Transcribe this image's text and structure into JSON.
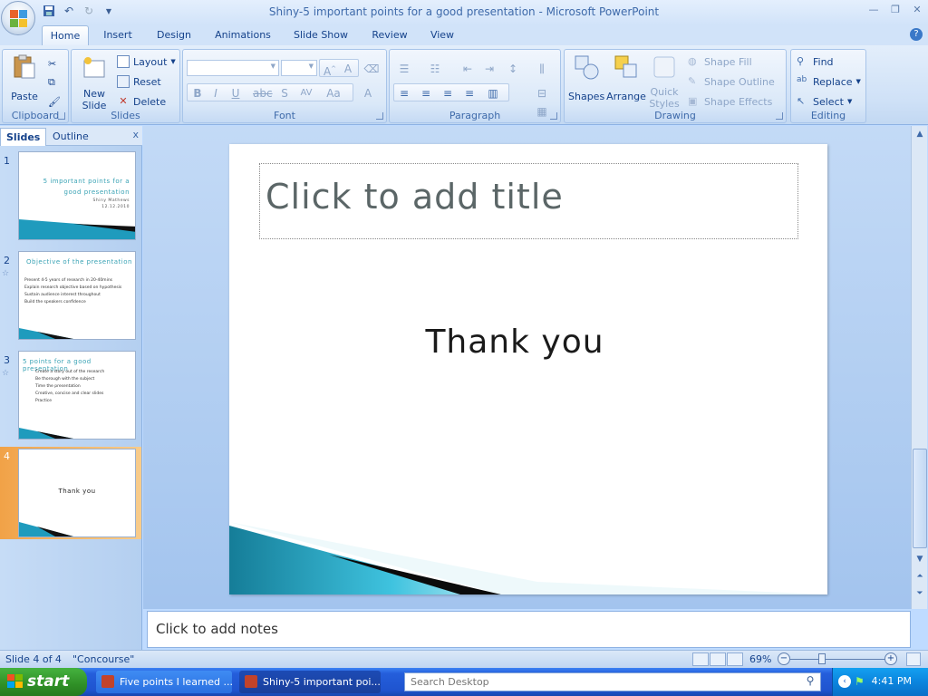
{
  "window": {
    "title": "Shiny-5 important points for a good presentation - Microsoft PowerPoint"
  },
  "tabs": [
    "Home",
    "Insert",
    "Design",
    "Animations",
    "Slide Show",
    "Review",
    "View"
  ],
  "ribbon": {
    "clipboard": {
      "label": "Clipboard",
      "paste": "Paste"
    },
    "slides": {
      "label": "Slides",
      "new_slide_1": "New",
      "new_slide_2": "Slide",
      "layout": "Layout",
      "reset": "Reset",
      "delete": "Delete"
    },
    "font": {
      "label": "Font"
    },
    "paragraph": {
      "label": "Paragraph"
    },
    "drawing": {
      "label": "Drawing",
      "shapes": "Shapes",
      "arrange": "Arrange",
      "quick_styles_1": "Quick",
      "quick_styles_2": "Styles",
      "shape_fill": "Shape Fill",
      "shape_outline": "Shape Outline",
      "shape_effects": "Shape Effects"
    },
    "editing": {
      "label": "Editing",
      "find": "Find",
      "replace": "Replace",
      "select": "Select"
    }
  },
  "pane": {
    "tab_slides": "Slides",
    "tab_outline": "Outline",
    "thumbnails": [
      {
        "num": "1",
        "title_1": "5 important points for a",
        "title_2": "good presentation",
        "sub_1": "Shiny Mathews",
        "sub_2": "12.12.2010"
      },
      {
        "num": "2",
        "title": "Objective of the presentation",
        "bullets": [
          "Present 4-5 years of research in 20-40mins",
          "Explain research objective based on hypothesis",
          "Sustain audience interest throughout",
          "Build the speakers confidence"
        ]
      },
      {
        "num": "3",
        "title": "5 points for a good presentation",
        "bullets": [
          "Create a story out of the research",
          "Be thorough with the subject",
          "Time the presentation",
          "Creative, concise and clear slides",
          "Practice"
        ]
      },
      {
        "num": "4",
        "body": "Thank you"
      }
    ]
  },
  "slide": {
    "title_placeholder": "Click to add title",
    "body": "Thank you"
  },
  "notes": {
    "placeholder": "Click to add notes"
  },
  "status": {
    "slide_of": "Slide 4 of 4",
    "theme": "\"Concourse\"",
    "zoom": "69%"
  },
  "taskbar": {
    "start": "start",
    "task1": "Five points I learned ...",
    "task2": "Shiny-5 important poi...",
    "search_placeholder": "Search Desktop",
    "clock": "4:41 PM"
  }
}
